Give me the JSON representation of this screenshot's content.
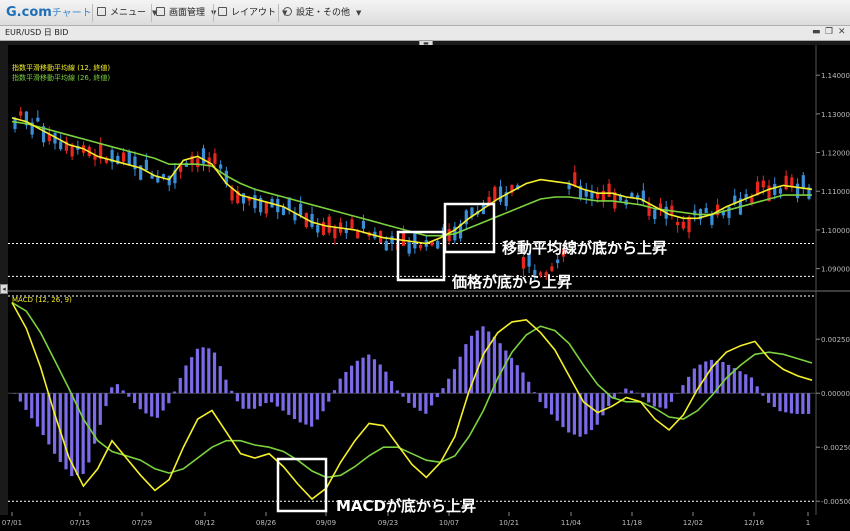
{
  "toolbar": {
    "logo": "G.com",
    "logo_sub": "チャート",
    "menu_label": "メニュー",
    "screen_label": "画面管理",
    "layout_label": "レイアウト",
    "settings_label": "設定・その他"
  },
  "window": {
    "symbol_label": "EUR/USD 日 BID",
    "collapse_glyph": "▬"
  },
  "colors": {
    "background": "#000000",
    "up_candle": "#e8271f",
    "down_candle": "#3a8fd8",
    "ema_fast": "#f5f02a",
    "ema_slow": "#7bd23f",
    "histogram": "#7b6be8",
    "annotation_box": "#ffffff",
    "reference_line": "#ffffff"
  },
  "chart_data": [
    {
      "type": "candlestick",
      "legend": [
        {
          "name": "指数平滑移動平均線 (12, 終値)",
          "color": "#f5f02a"
        },
        {
          "name": "指数平滑移動平均線 (26, 終値)",
          "color": "#7bd23f"
        }
      ],
      "ylim": [
        1.0855,
        1.146
      ],
      "yticks": [
        "1.14000",
        "1.13000",
        "1.12000",
        "1.11000",
        "1.10000",
        "1.09000"
      ],
      "ytick_values": [
        1.14,
        1.13,
        1.12,
        1.11,
        1.1,
        1.09
      ],
      "reference_lines": [
        1.0965,
        1.088
      ],
      "ema12": [
        1.129,
        1.128,
        1.126,
        1.124,
        1.122,
        1.121,
        1.119,
        1.118,
        1.117,
        1.116,
        1.114,
        1.113,
        1.118,
        1.119,
        1.117,
        1.112,
        1.109,
        1.108,
        1.107,
        1.106,
        1.104,
        1.102,
        1.101,
        1.1005,
        1.1,
        1.099,
        1.098,
        1.0975,
        1.097,
        1.0965,
        1.098,
        1.1,
        1.103,
        1.1055,
        1.108,
        1.11,
        1.112,
        1.113,
        1.1125,
        1.112,
        1.1105,
        1.1095,
        1.1095,
        1.1085,
        1.108,
        1.106,
        1.104,
        1.103,
        1.103,
        1.104,
        1.106,
        1.1075,
        1.109,
        1.1105,
        1.1115,
        1.111,
        1.1105
      ],
      "ema26": [
        1.128,
        1.1275,
        1.1265,
        1.1255,
        1.1245,
        1.1235,
        1.1225,
        1.1215,
        1.1205,
        1.1195,
        1.1185,
        1.117,
        1.117,
        1.117,
        1.1165,
        1.114,
        1.112,
        1.1105,
        1.1095,
        1.1085,
        1.1075,
        1.1065,
        1.1055,
        1.1045,
        1.1035,
        1.1025,
        1.1015,
        1.1005,
        1.0995,
        1.0985,
        1.0985,
        1.099,
        1.1005,
        1.102,
        1.1035,
        1.105,
        1.1065,
        1.108,
        1.1085,
        1.1085,
        1.108,
        1.1075,
        1.1075,
        1.107,
        1.1065,
        1.1055,
        1.105,
        1.1045,
        1.104,
        1.104,
        1.105,
        1.106,
        1.107,
        1.108,
        1.109,
        1.109,
        1.109
      ]
    },
    {
      "type": "macd",
      "legend": [
        {
          "name": "MACD (12, 26, 9)",
          "color": "#f5f02a"
        }
      ],
      "ylim": [
        -0.0055,
        0.0045
      ],
      "yticks": [
        "0.00250",
        "0.00000",
        "-0.00250",
        "-0.00500"
      ],
      "ytick_values": [
        0.0025,
        0.0,
        -0.0025,
        -0.005
      ],
      "reference_lines": [
        0.0045,
        -0.005
      ]
    }
  ],
  "x_axis": {
    "labels": [
      "07/01",
      "07/15",
      "07/29",
      "08/12",
      "08/26",
      "09/09",
      "09/23",
      "10/07",
      "10/21",
      "11/04",
      "11/18",
      "12/02",
      "12/16",
      "1"
    ]
  },
  "annotations": {
    "ema_label": "移動平均線が底から上昇",
    "price_label": "価格が底から上昇",
    "macd_label": "MACDが底から上昇"
  }
}
